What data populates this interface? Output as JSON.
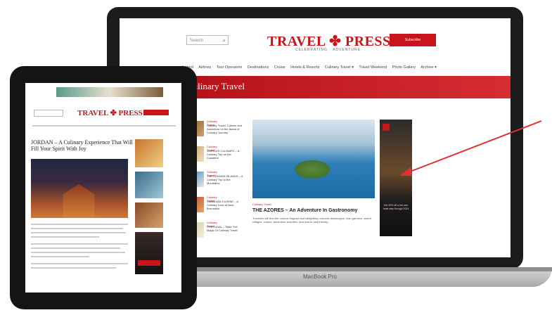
{
  "laptop": {
    "search_placeholder": "Search",
    "logo_text": "TRAVEL ✤ PRESS",
    "tagline": "CELEBRATING · ADVENTURE",
    "subscribe_label": "Subscribe",
    "nav_items": [
      "Latest",
      "Airlines",
      "Tour Operators",
      "Destinations",
      "Cruise",
      "Hotels & Resorts",
      "Culinary Travel ▾",
      "Travel Weekend",
      "Photo Gallery",
      "Archive ▾"
    ],
    "section_title": "Culinary Travel",
    "sidebar_posts": [
      {
        "category": "Culinary Travel",
        "text": "Culinary Travel: Cuisine and Adventure on the island of Culinary Journey"
      },
      {
        "category": "Culinary Travel",
        "text": "CURIOUS CULINARY – A Culinary Trip on the Coastline"
      },
      {
        "category": "Culinary Travel",
        "text": "THE SPANISH ISLANDS – A Culinary Trip to the Mountains"
      },
      {
        "category": "Culinary Travel",
        "text": "CANADIAN CUISINE – A Culinary Look at New Brunswick"
      },
      {
        "category": "Culinary Travel",
        "text": "PORTUGAL – Taste The Magic Of Culinary Travel"
      }
    ],
    "feature_category": "Culinary Travel",
    "feature_title": "THE AZORES – An Adventure In Gastronomy",
    "feature_desc": "Travelers will find the various fragrant and delightfully volcanic landscapes, lush gardens, sweet villages, culture, adventure activities, and scenic and friendly...",
    "ad_text": "Get 30% off a five-star hotel stay through 2024",
    "device_label": "MacBook Pro"
  },
  "tablet": {
    "logo_text": "TRAVEL ✤ PRESS",
    "article_title": "JORDAN – A Culinary Experience That Will Fill Your Spirit With Joy"
  },
  "colors": {
    "brand_red": "#c8151b",
    "arrow_red": "#e03131"
  }
}
